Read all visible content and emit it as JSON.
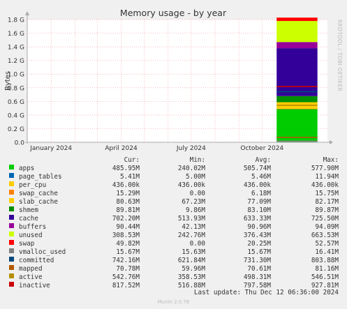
{
  "chart_data": {
    "type": "area",
    "title": "Memory usage - by year",
    "ylabel": "Bytes",
    "ylim": [
      0,
      1.8
    ],
    "yunit": "G",
    "yticks": [
      "0.0",
      "0.2 G",
      "0.4 G",
      "0.6 G",
      "0.8 G",
      "1.0 G",
      "1.2 G",
      "1.4 G",
      "1.6 G",
      "1.8 G"
    ],
    "ytick_values": [
      0,
      0.2,
      0.4,
      0.6,
      0.8,
      1.0,
      1.2,
      1.4,
      1.6,
      1.8
    ],
    "xlim": [
      "2023-12-01",
      "2024-12-25"
    ],
    "xticks": [
      {
        "date": "2024-01-01",
        "label": "January 2024"
      },
      {
        "date": "2024-04-01",
        "label": "April 2024"
      },
      {
        "date": "2024-07-01",
        "label": "July 2024"
      },
      {
        "date": "2024-10-01",
        "label": "October 2024"
      }
    ],
    "data_start": "2024-10-20",
    "data_end": "2024-12-12",
    "stack": [
      {
        "name": "apps",
        "color": "#00cc00",
        "value": 0.4859
      },
      {
        "name": "page_tables",
        "color": "#0066b3",
        "value": 0.0054
      },
      {
        "name": "per_cpu",
        "color": "#ff8000",
        "value": 0.0004
      },
      {
        "name": "swap_cache",
        "color": "#ffcc00",
        "value": 0.0153
      },
      {
        "name": "slab_cache",
        "color": "#ffcc00",
        "value": 0.0806
      },
      {
        "name": "shmem",
        "color": "#008f00",
        "value": 0.0898
      },
      {
        "name": "cache",
        "color": "#330099",
        "value": 0.7022
      },
      {
        "name": "buffers",
        "color": "#990099",
        "value": 0.0904
      },
      {
        "name": "unused",
        "color": "#ccff00",
        "value": 0.3085
      },
      {
        "name": "swap",
        "color": "#ff0000",
        "value": 0.0498
      }
    ],
    "lines": [
      {
        "name": "vmalloc_used",
        "color": "#808080",
        "value": 0.0157
      },
      {
        "name": "committed",
        "color": "#00487d",
        "value": 0.7422
      },
      {
        "name": "mapped",
        "color": "#b35a00",
        "value": 0.0708
      },
      {
        "name": "active",
        "color": "#b38f00",
        "value": 0.5428
      },
      {
        "name": "inactive",
        "color": "#cc0000",
        "value": 0.8175
      }
    ],
    "grid": true,
    "legend_placement": "bottom"
  },
  "side_text": "RRDTOOL / TOBI OETIKER",
  "legend": {
    "headers": {
      "cur": "Cur:",
      "min": "Min:",
      "avg": "Avg:",
      "max": "Max:"
    },
    "rows": [
      {
        "name": "apps",
        "color": "#00cc00",
        "cur": "485.95M",
        "min": "240.02M",
        "avg": "505.74M",
        "max": "577.90M"
      },
      {
        "name": "page_tables",
        "color": "#0066b3",
        "cur": "5.41M",
        "min": "5.00M",
        "avg": "5.46M",
        "max": "11.94M"
      },
      {
        "name": "per_cpu",
        "color": "#ffcc00",
        "cur": "436.00k",
        "min": "436.00k",
        "avg": "436.00k",
        "max": "436.00k"
      },
      {
        "name": "swap_cache",
        "color": "#ff8000",
        "cur": "15.29M",
        "min": "0.00",
        "avg": "6.18M",
        "max": "15.75M"
      },
      {
        "name": "slab_cache",
        "color": "#ffcc00",
        "cur": "80.63M",
        "min": "67.23M",
        "avg": "77.09M",
        "max": "82.17M"
      },
      {
        "name": "shmem",
        "color": "#008f00",
        "cur": "89.81M",
        "min": "9.86M",
        "avg": "83.10M",
        "max": "89.87M"
      },
      {
        "name": "cache",
        "color": "#330099",
        "cur": "702.20M",
        "min": "513.93M",
        "avg": "633.33M",
        "max": "725.50M"
      },
      {
        "name": "buffers",
        "color": "#990099",
        "cur": "90.44M",
        "min": "42.13M",
        "avg": "90.96M",
        "max": "94.09M"
      },
      {
        "name": "unused",
        "color": "#ccff00",
        "cur": "308.53M",
        "min": "242.76M",
        "avg": "376.43M",
        "max": "663.53M"
      },
      {
        "name": "swap",
        "color": "#ff0000",
        "cur": "49.82M",
        "min": "0.00",
        "avg": "20.25M",
        "max": "52.57M"
      },
      {
        "name": "vmalloc_used",
        "color": "#808080",
        "cur": "15.67M",
        "min": "15.63M",
        "avg": "15.67M",
        "max": "16.41M"
      },
      {
        "name": "committed",
        "color": "#00487d",
        "cur": "742.16M",
        "min": "621.84M",
        "avg": "731.30M",
        "max": "803.88M"
      },
      {
        "name": "mapped",
        "color": "#b35a00",
        "cur": "70.78M",
        "min": "59.96M",
        "avg": "70.61M",
        "max": "81.16M"
      },
      {
        "name": "active",
        "color": "#b38f00",
        "cur": "542.76M",
        "min": "358.53M",
        "avg": "498.31M",
        "max": "546.51M"
      },
      {
        "name": "inactive",
        "color": "#cc0000",
        "cur": "817.52M",
        "min": "516.88M",
        "avg": "797.58M",
        "max": "927.81M"
      }
    ]
  },
  "footer": {
    "last_update": "Last update: Thu Dec 12 06:36:00 2024",
    "version": "Munin 2.0.76"
  }
}
